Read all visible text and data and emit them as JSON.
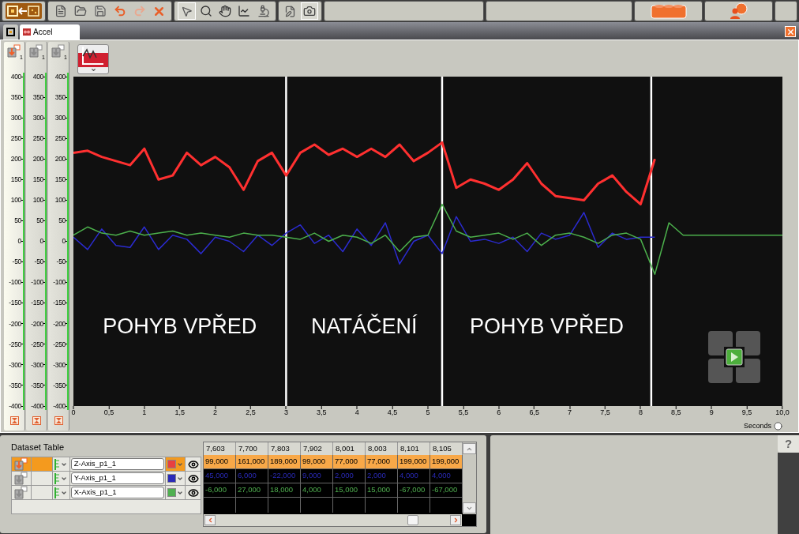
{
  "tabs": [
    {
      "kind": "icon",
      "selected": false
    },
    {
      "kind": "text",
      "label": "Accel",
      "selected": true
    }
  ],
  "axis_strips": [
    {
      "selected": true,
      "channel": "1",
      "labels": [
        "400",
        "350",
        "300",
        "250",
        "200",
        "150",
        "100",
        "50",
        "0",
        "-50",
        "-100",
        "-150",
        "-200",
        "-250",
        "-300",
        "-350",
        "-400"
      ]
    },
    {
      "selected": false,
      "channel": "1",
      "labels": [
        "400",
        "350",
        "300",
        "250",
        "200",
        "150",
        "100",
        "50",
        "0",
        "-50",
        "-100",
        "-150",
        "-200",
        "-250",
        "-300",
        "-350",
        "-400"
      ]
    },
    {
      "selected": false,
      "channel": "1"
    }
  ],
  "chart": {
    "chart_data": {
      "type": "line",
      "xlabel": "Seconds",
      "xlim": [
        0,
        10
      ],
      "ylim": [
        -400,
        400
      ],
      "xticks": [
        {
          "value": 0,
          "label": "0"
        },
        {
          "value": 0.5,
          "label": "0,5"
        },
        {
          "value": 1,
          "label": "1"
        },
        {
          "value": 1.5,
          "label": "1,5"
        },
        {
          "value": 2,
          "label": "2"
        },
        {
          "value": 2.5,
          "label": "2,5"
        },
        {
          "value": 3,
          "label": "3"
        },
        {
          "value": 3.5,
          "label": "3,5"
        },
        {
          "value": 4,
          "label": "4"
        },
        {
          "value": 4.5,
          "label": "4,5"
        },
        {
          "value": 5,
          "label": "5"
        },
        {
          "value": 5.5,
          "label": "5,5"
        },
        {
          "value": 6,
          "label": "6"
        },
        {
          "value": 6.5,
          "label": "6,5"
        },
        {
          "value": 7,
          "label": "7"
        },
        {
          "value": 7.5,
          "label": "7,5"
        },
        {
          "value": 8,
          "label": "8"
        },
        {
          "value": 8.5,
          "label": "8,5"
        },
        {
          "value": 9,
          "label": "9"
        },
        {
          "value": 9.5,
          "label": "9,5"
        },
        {
          "value": 10,
          "label": "10,0"
        }
      ],
      "yticks": [
        400,
        350,
        300,
        250,
        200,
        150,
        100,
        50,
        0,
        -50,
        -100,
        -150,
        -200,
        -250,
        -300,
        -350,
        -400
      ],
      "x": [
        0,
        0.2,
        0.4,
        0.6,
        0.8,
        1,
        1.2,
        1.4,
        1.6,
        1.8,
        2,
        2.2,
        2.4,
        2.6,
        2.8,
        3,
        3.2,
        3.4,
        3.6,
        3.8,
        4,
        4.2,
        4.4,
        4.6,
        4.8,
        5,
        5.2,
        5.4,
        5.6,
        5.8,
        6,
        6.2,
        6.4,
        6.6,
        6.8,
        7,
        7.2,
        7.4,
        7.6,
        7.8,
        8,
        8.2,
        8.4,
        8.6,
        8.8,
        9,
        9.2,
        9.4,
        9.6,
        9.8,
        10
      ],
      "series": [
        {
          "color": "#ff3030",
          "values": [
            215,
            220,
            205,
            195,
            185,
            225,
            150,
            160,
            215,
            185,
            205,
            180,
            125,
            195,
            215,
            160,
            215,
            235,
            210,
            225,
            205,
            225,
            205,
            235,
            195,
            215,
            240,
            130,
            150,
            140,
            125,
            150,
            190,
            140,
            110,
            105,
            100,
            140,
            160,
            120,
            90,
            200,
            null,
            null,
            null,
            null,
            null,
            null,
            null,
            null,
            null
          ]
        },
        {
          "color": "#2b2bd0",
          "values": [
            10,
            -20,
            30,
            -10,
            -15,
            35,
            -20,
            15,
            5,
            -30,
            10,
            0,
            -25,
            15,
            -10,
            20,
            40,
            -5,
            15,
            -25,
            30,
            -10,
            45,
            -55,
            0,
            15,
            -30,
            60,
            0,
            5,
            -5,
            10,
            -25,
            20,
            5,
            15,
            70,
            -15,
            20,
            5,
            10,
            10,
            null,
            null,
            null,
            null,
            null,
            null,
            null,
            null,
            null
          ]
        },
        {
          "color": "#4cb04c",
          "values": [
            15,
            35,
            20,
            15,
            25,
            15,
            20,
            25,
            15,
            20,
            15,
            10,
            20,
            15,
            15,
            10,
            5,
            20,
            0,
            15,
            10,
            -5,
            15,
            -25,
            10,
            15,
            90,
            25,
            10,
            15,
            20,
            5,
            20,
            -10,
            15,
            20,
            10,
            -5,
            15,
            20,
            5,
            -80,
            45,
            15,
            15,
            15,
            15,
            15,
            15,
            15,
            15
          ]
        }
      ],
      "ref_lines": [
        {
          "axis": "x",
          "value": 3.0
        },
        {
          "axis": "x",
          "value": 5.2
        },
        {
          "axis": "x",
          "value": 8.15
        }
      ],
      "annotations": [
        "POHYB VPŘED",
        "NATÁČENÍ",
        "POHYB VPŘED"
      ]
    }
  },
  "dataset_table": {
    "title": "Dataset Table",
    "columns": [
      "7,603",
      "7,700",
      "7,803",
      "7,902",
      "8,001",
      "8,003",
      "8,101",
      "8,105"
    ],
    "rows": [
      {
        "name": "Z-Axis_p1_1",
        "color": "#e84040",
        "selected": true,
        "values": [
          "99,000",
          "161,000",
          "189,000",
          "99,000",
          "77,000",
          "77,000",
          "199,000",
          "199,000"
        ]
      },
      {
        "name": "Y-Axis_p1_1",
        "color": "#2a2ab8",
        "selected": false,
        "values": [
          "45,000",
          "6,000",
          "-22,000",
          "9,000",
          "2,000",
          "2,000",
          "4,000",
          "4,000"
        ]
      },
      {
        "name": "X-Axis_p1_1",
        "color": "#50b050",
        "selected": false,
        "values": [
          "-6,000",
          "27,000",
          "18,000",
          "4,000",
          "15,000",
          "15,000",
          "-67,000",
          "-67,000"
        ]
      }
    ]
  },
  "help": {
    "label": "?"
  }
}
